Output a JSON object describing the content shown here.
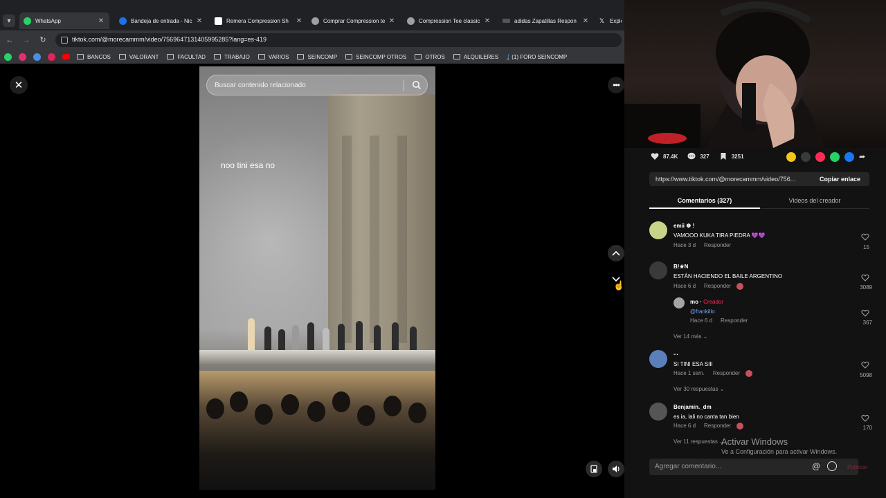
{
  "browser": {
    "tabs": [
      {
        "title": "WhatsApp",
        "color": "#25d366"
      },
      {
        "title": "Bandeja de entrada - Nic",
        "color": "#1a73e8"
      },
      {
        "title": "Remera Compression Sh",
        "color": "#ffffff"
      },
      {
        "title": "Comprar Compression te",
        "color": "#9aa0a6"
      },
      {
        "title": "Compression Tee classic f",
        "color": "#9aa0a6"
      },
      {
        "title": "adidas Zapatillas Respon",
        "color": "#111111"
      },
      {
        "title": "Explot",
        "color": "#111111"
      }
    ],
    "url": "tiktok.com/@morecammm/video/7569647131405995285?lang=es-419",
    "bookmarks": [
      "BANCOS",
      "VALORANT",
      "FACULTAD",
      "TRABAJO",
      "VARIOS",
      "SEINCOMP",
      "SEINCOMP OTROS",
      "OTROS",
      "ALQUILERES",
      "(1) FORO SEINCOMP"
    ]
  },
  "video": {
    "search_placeholder": "Buscar contenido relacionado",
    "caption": "noo tini esa no"
  },
  "panel": {
    "likes": "87.4K",
    "comments_count": "327",
    "saves": "3251",
    "share_colors": [
      "#f5c518",
      "#3a3a3a",
      "#fe2c55",
      "#25d366",
      "#1877f2"
    ],
    "link": "https://www.tiktok.com/@morecammm/video/756...",
    "copy_label": "Copiar enlace",
    "tab_comments": "Comentarios (327)",
    "tab_creator": "Videos del creador",
    "reply_label": "Responder",
    "creator_label": "Creador",
    "comments": [
      {
        "name": "emii ☸ !",
        "text": "VAMOOO KUKA TIRA PIEDRA 💜💜",
        "time": "Hace 3 d",
        "likes": "15",
        "avatar": "#c8d48a"
      },
      {
        "name": "B!★N",
        "text": "ESTÁN HACIENDO EL BAILE ARGENTINO",
        "time": "Hace 6 d",
        "likes": "3089",
        "avatar": "#3a3a3a"
      },
      {
        "name": "mo",
        "text": "@frankillo",
        "time": "Hace 6 d",
        "likes": "367",
        "avatar": "#a5a5a5"
      },
      {
        "name": "...",
        "text": "SI TINI ESA SIII",
        "time": "Hace 1 sem.",
        "likes": "5098",
        "avatar": "#5b7fb8"
      },
      {
        "name": "Benjamin._dm",
        "text": "es ia, lali no canta tan bien",
        "time": "Hace 6 d",
        "likes": "170",
        "avatar": "#555555"
      }
    ],
    "more_replies": [
      "Ver 14 más",
      "Ver 30 respuestas",
      "Ver 11 respuestas"
    ],
    "comment_placeholder": "Agregar comentario...",
    "post_label": "Publicar"
  },
  "watermark": {
    "title": "Activar Windows",
    "subtitle": "Ve a Configuración para activar Windows."
  }
}
